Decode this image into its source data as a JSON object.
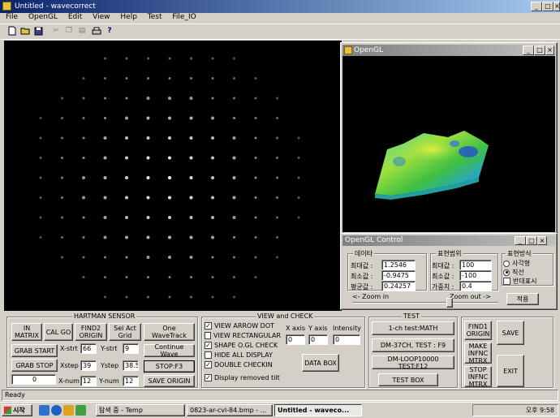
{
  "app": {
    "title": "Untitled - wavecorrect",
    "menu": [
      "File",
      "OpenGL",
      "Edit",
      "View",
      "Help",
      "Test",
      "File_IO"
    ]
  },
  "opengl_window": {
    "title": "OpenGL"
  },
  "opengl_control": {
    "title": "OpenGL Control",
    "data_group": {
      "title": "데이타",
      "max_label": "최대값 :",
      "max_value": "1.2546",
      "min_label": "최소값 :",
      "min_value": "-0.9475",
      "avg_label": "평균값 :",
      "avg_value": "0.24257"
    },
    "range_group": {
      "title": "표현범위",
      "max_label": "최대값 :",
      "max_value": "100",
      "min_label": "최소값 :",
      "min_value": "-100",
      "weight_label": "가중치 :",
      "weight_value": "0.4"
    },
    "mode_group": {
      "title": "표현방식",
      "opt1": "사각형",
      "opt2": "직선",
      "reverse": "반대표시"
    },
    "zoom_in": "<- Zoom in",
    "zoom_out": "Zoom out ->",
    "apply": "적용"
  },
  "hartman": {
    "title": "HARTMAN SENSOR",
    "in_matrix": "IN MATRIX",
    "cal_go": "CAL GO",
    "find2_origin": "FIND2 ORIGIN",
    "sel_act_grid": "Sel Act Grid",
    "one_wavetrack": "One WaveTrack",
    "grab_start": "GRAB START",
    "grab_stop": "GRAB STOP",
    "counter": "0",
    "continue_wave": "Continue Wave",
    "stop_f3": "STOP:F3",
    "save_origin": "SAVE ORIGIN",
    "xstrt_label": "X-strt",
    "xstrt": "66",
    "ystrt_label": "Y-strt",
    "ystrt": "9",
    "xstep_label": "Xstep",
    "xstep": "39",
    "ystep_label": "Ystep",
    "ystep": "38.5",
    "xnum_label": "X-num",
    "xnum": "12",
    "ynum_label": "Y-num",
    "ynum": "12"
  },
  "view_check": {
    "title": "VIEW and CHECK",
    "view_arrow_dot": "VIEW ARROW DOT",
    "view_rectangular": "VIEW RECTANGULAR",
    "shape_ogl": "SHAPE O.GL CHECK",
    "hide_all": "HIDE ALL DISPLAY",
    "double_check": "DOUBLE CHECKIN",
    "display_tilt": "Display removed tilt",
    "x_axis": "X axis",
    "x_axis_val": "0",
    "y_axis": "Y axis",
    "y_axis_val": "0",
    "intensity": "Intensity",
    "intensity_val": "0",
    "data_box": "DATA BOX"
  },
  "test": {
    "title": "TEST",
    "ch1_math": "1-ch test:MATH",
    "dm37": "DM-37CH, TEST : F9",
    "dm_loop": "DM-LOOP10000 TEST:F12",
    "test_box": "TEST BOX"
  },
  "right_panel": {
    "find1_origin": "FIND1 ORIGIN",
    "save": "SAVE",
    "make_infnc": "MAKE INFNC MTRX",
    "stop_infnc": "STOP INFNC MTRX",
    "exit": "EXIT"
  },
  "status": "Ready",
  "taskbar": {
    "start": "시작",
    "tasks": [
      "탐색 중 - Temp",
      "0823-ar-cvl-84.bmp - ...",
      "Untitled - waveco..."
    ],
    "clock": "오후 9:58"
  },
  "colors": {
    "title_active": "#0a246a",
    "face": "#d4d0c8",
    "desktop": "#000000"
  }
}
